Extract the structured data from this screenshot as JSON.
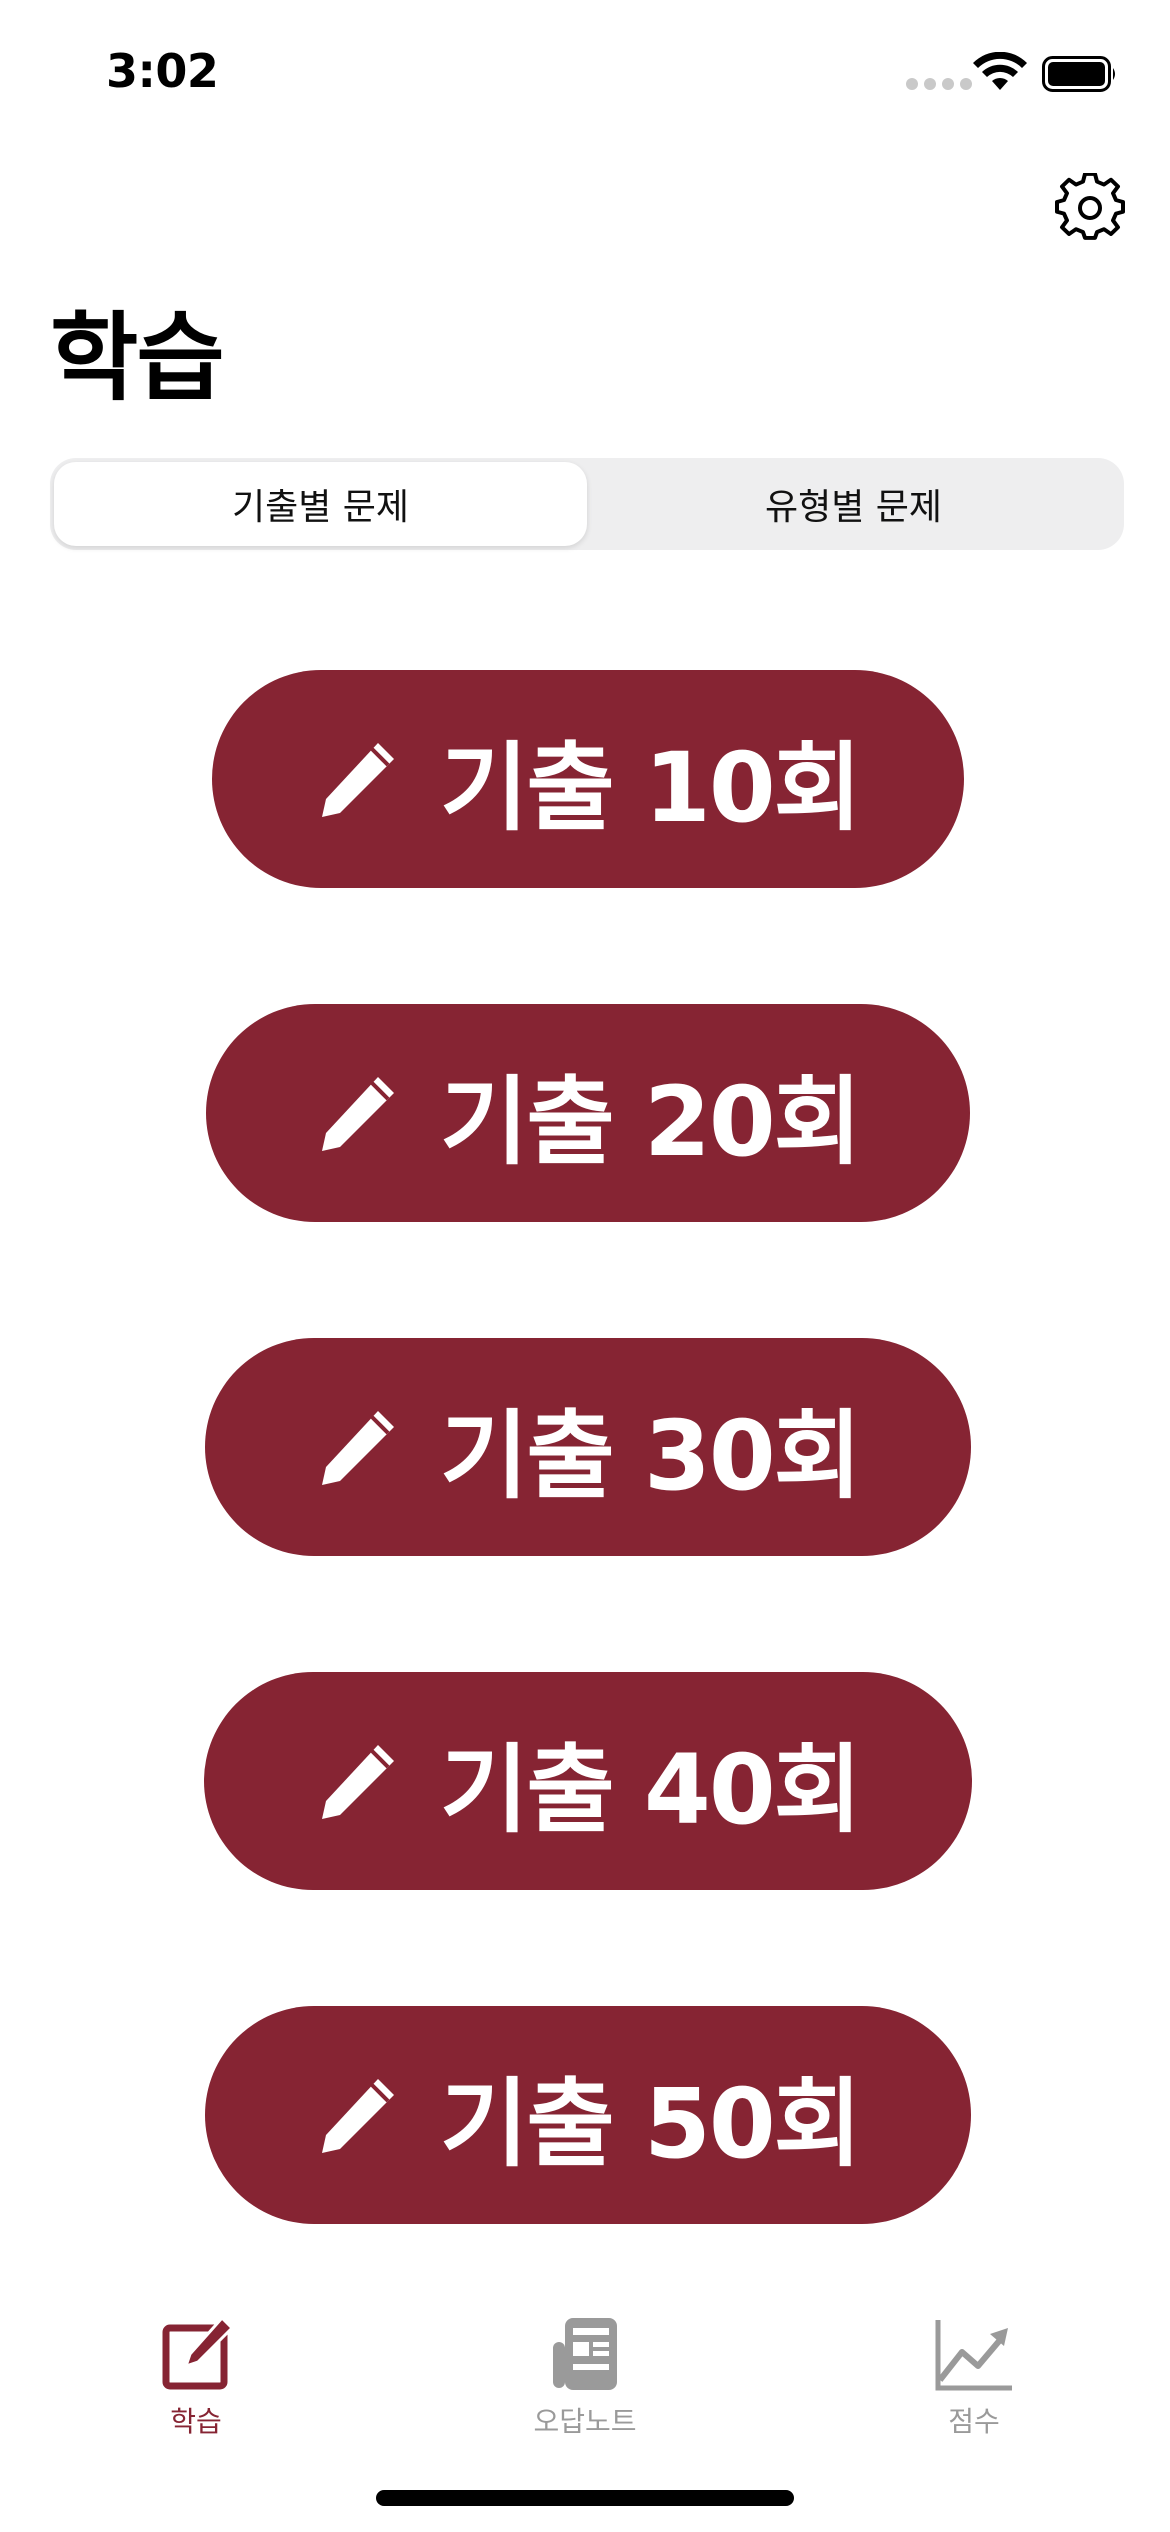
{
  "status_bar": {
    "time": "3:02"
  },
  "header": {
    "title": "학습",
    "settings_icon": "gear-icon"
  },
  "segments": [
    {
      "label": "기출별 문제",
      "selected": true
    },
    {
      "label": "유형별 문제",
      "selected": false
    }
  ],
  "exam_buttons": [
    {
      "icon": "pencil-icon",
      "label": "기출 10회"
    },
    {
      "icon": "pencil-icon",
      "label": "기출 20회"
    },
    {
      "icon": "pencil-icon",
      "label": "기출 30회"
    },
    {
      "icon": "pencil-icon",
      "label": "기출 40회"
    },
    {
      "icon": "pencil-icon",
      "label": "기출 50회"
    }
  ],
  "tab_bar": {
    "items": [
      {
        "label": "학습",
        "icon": "edit-square-icon",
        "active": true
      },
      {
        "label": "오답노트",
        "icon": "newspaper-icon",
        "active": false
      },
      {
        "label": "점수",
        "icon": "chart-line-icon",
        "active": false
      }
    ]
  },
  "colors": {
    "accent": "#862433",
    "inactive_tab": "#9a9a9a",
    "segment_bg": "#eeeeef"
  }
}
